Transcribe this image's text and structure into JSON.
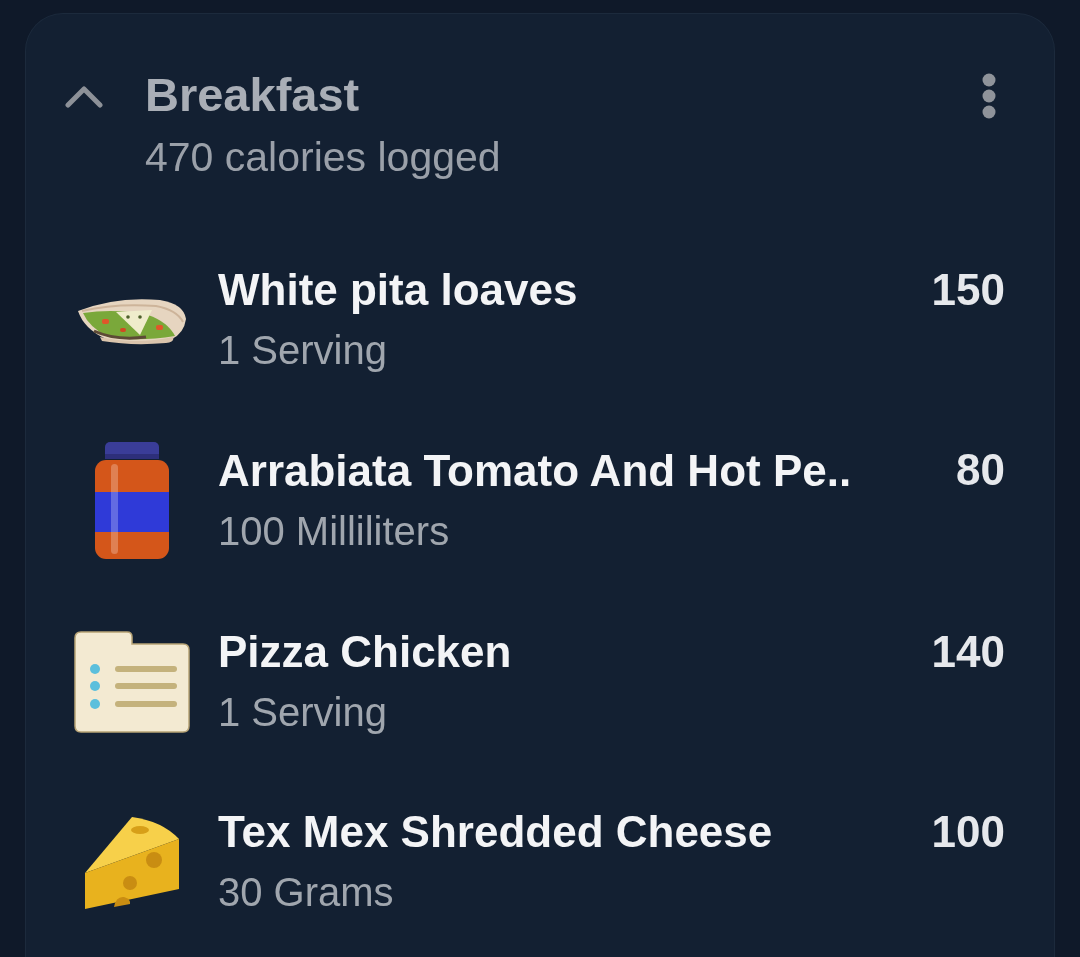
{
  "meal": {
    "title": "Breakfast",
    "summary": "470 calories logged",
    "expanded": true
  },
  "items": [
    {
      "kind": "pita",
      "name": "White pita loaves",
      "serving": "1 Serving",
      "calories": "150"
    },
    {
      "kind": "jar",
      "name": "Arrabiata Tomato And Hot Pe..",
      "serving": "100 Milliliters",
      "calories": "80"
    },
    {
      "kind": "list",
      "name": "Pizza Chicken",
      "serving": "1 Serving",
      "calories": "140"
    },
    {
      "kind": "cheese",
      "name": "Tex Mex Shredded Cheese",
      "serving": "30 Grams",
      "calories": "100"
    }
  ]
}
